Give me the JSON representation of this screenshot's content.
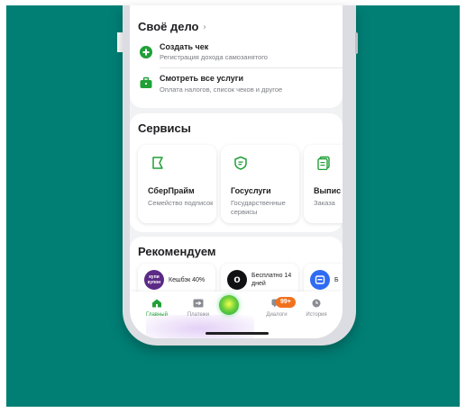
{
  "own_business": {
    "title": "Своё дело",
    "items": [
      {
        "title": "Создать чек",
        "subtitle": "Регистрация дохода самозанятого"
      },
      {
        "title": "Смотреть все услуги",
        "subtitle": "Оплата налогов, список чеков и другое"
      }
    ]
  },
  "services": {
    "title": "Сервисы",
    "cards": [
      {
        "title": "СберПрайм",
        "subtitle": "Семейство подписок"
      },
      {
        "title": "Госуслуги",
        "subtitle": "Государственные сервисы"
      },
      {
        "title": "Выпис справ",
        "subtitle": "Заказа"
      }
    ]
  },
  "recommend": {
    "title": "Рекомендуем",
    "cards": [
      {
        "logo": "купи купон",
        "text": "Кешбэк 40%"
      },
      {
        "logo": "о",
        "text": "Бесплатно 14 дней"
      },
      {
        "logo": "",
        "text": "Б"
      }
    ]
  },
  "tabbar": {
    "items": [
      {
        "label": "Главный",
        "icon": "home-icon",
        "active": true
      },
      {
        "label": "Платежи",
        "icon": "payments-icon",
        "active": false
      },
      {
        "label": "",
        "icon": "assistant-orb-icon",
        "active": false
      },
      {
        "label": "Диалоги",
        "icon": "dialogs-icon",
        "active": false
      },
      {
        "label": "История",
        "icon": "history-icon",
        "active": false
      }
    ],
    "badge": "99+"
  },
  "colors": {
    "background": "#017f75",
    "accent_green": "#21a038",
    "badge_orange": "#f2711c"
  }
}
